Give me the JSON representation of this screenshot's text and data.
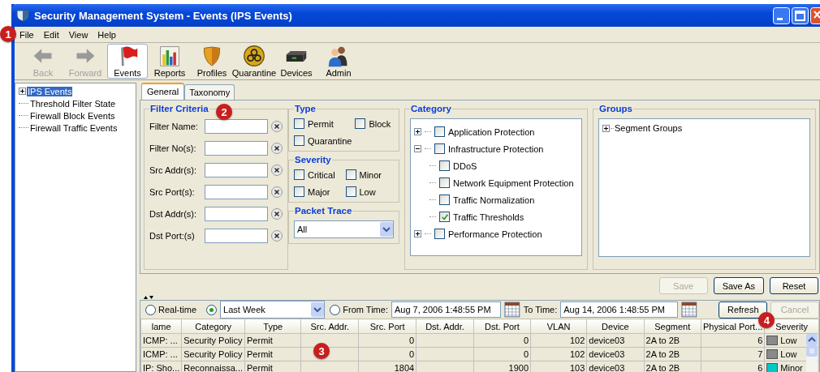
{
  "window": {
    "title": "Security Management System - Events (IPS Events)"
  },
  "menu": {
    "items": [
      "File",
      "Edit",
      "View",
      "Help"
    ],
    "callout": "1"
  },
  "toolbar": [
    {
      "label": "Back",
      "kind": "back",
      "disabled": true,
      "selected": false
    },
    {
      "label": "Forward",
      "kind": "forward",
      "disabled": true,
      "selected": false
    },
    {
      "label": "Events",
      "kind": "events",
      "disabled": false,
      "selected": true
    },
    {
      "label": "Reports",
      "kind": "reports",
      "disabled": false,
      "selected": false
    },
    {
      "label": "Profiles",
      "kind": "profiles",
      "disabled": false,
      "selected": false
    },
    {
      "label": "Quarantine",
      "kind": "quarantine",
      "disabled": false,
      "selected": false
    },
    {
      "label": "Devices",
      "kind": "devices",
      "disabled": false,
      "selected": false
    },
    {
      "label": "Admin",
      "kind": "admin",
      "disabled": false,
      "selected": false
    }
  ],
  "sidebar": {
    "items": [
      {
        "label": "IPS Events",
        "selected": true,
        "expandable": true
      },
      {
        "label": "Threshold Filter State",
        "selected": false,
        "expandable": false
      },
      {
        "label": "Firewall Block Events",
        "selected": false,
        "expandable": false
      },
      {
        "label": "Firewall Traffic Events",
        "selected": false,
        "expandable": false
      }
    ]
  },
  "tabs": [
    {
      "label": "General",
      "selected": true
    },
    {
      "label": "Taxonomy",
      "selected": false
    }
  ],
  "filter_criteria": {
    "title": "Filter Criteria",
    "callout": "2",
    "fields": [
      "Filter Name:",
      "Filter No(s):",
      "Src Addr(s):",
      "Src Port(s):",
      "Dst Addr(s):",
      "Dst Port:(s)"
    ]
  },
  "type": {
    "title": "Type",
    "options": [
      {
        "label": "Permit",
        "checked": false
      },
      {
        "label": "Block",
        "checked": false
      },
      {
        "label": "Quarantine",
        "checked": false
      }
    ]
  },
  "severity": {
    "title": "Severity",
    "options": [
      {
        "label": "Critical",
        "checked": false
      },
      {
        "label": "Minor",
        "checked": false
      },
      {
        "label": "Major",
        "checked": false
      },
      {
        "label": "Low",
        "checked": false
      }
    ]
  },
  "packet_trace": {
    "title": "Packet Trace",
    "value": "All"
  },
  "category": {
    "title": "Category",
    "items": [
      {
        "label": "Application Protection",
        "checked": false,
        "expanded": false
      },
      {
        "label": "Infrastructure Protection",
        "checked": false,
        "expanded": true,
        "children": [
          {
            "label": "DDoS",
            "checked": false
          },
          {
            "label": "Network Equipment Protection",
            "checked": false
          },
          {
            "label": "Traffic Normalization",
            "checked": false
          },
          {
            "label": "Traffic Thresholds",
            "checked": true
          }
        ]
      },
      {
        "label": "Performance Protection",
        "checked": false,
        "expanded": false
      }
    ]
  },
  "groups": {
    "title": "Groups",
    "items": [
      {
        "label": "Segment Groups",
        "expanded": false
      }
    ]
  },
  "buttons": [
    {
      "label": "Save",
      "disabled": true
    },
    {
      "label": "Save As",
      "disabled": false
    },
    {
      "label": "Reset",
      "disabled": false
    }
  ],
  "time_range": {
    "realtime": {
      "label": "Real-time",
      "selected": false
    },
    "preset": {
      "value": "Last Week",
      "selected": true
    },
    "from": {
      "label": "From Time:",
      "selected": false,
      "value": "Aug 7, 2006 1:48:55 PM"
    },
    "to": {
      "label": "To Time:",
      "value": "Aug 14, 2006 1:48:55 PM"
    },
    "buttons": [
      {
        "label": "Refresh",
        "disabled": false
      },
      {
        "label": "Cancel",
        "disabled": true
      }
    ]
  },
  "table": {
    "callout": "3",
    "columns": [
      {
        "label": "lame"
      },
      {
        "label": "Category"
      },
      {
        "label": "Type"
      },
      {
        "label": "Src. Addr."
      },
      {
        "label": "Src. Port"
      },
      {
        "label": "Dst. Addr."
      },
      {
        "label": "Dst. Port"
      },
      {
        "label": "VLAN"
      },
      {
        "label": "Device"
      },
      {
        "label": "Segment"
      },
      {
        "label": "Physical Port..."
      },
      {
        "label": "Severity",
        "callout": "4"
      }
    ],
    "rows": [
      {
        "cells": [
          "ICMP: ...",
          "Security Policy",
          "Permit",
          null,
          "0",
          null,
          "0",
          "102",
          "device03",
          "2A to 2B",
          "6"
        ],
        "severity": {
          "label": "Low",
          "color": "#8a8a8a"
        }
      },
      {
        "cells": [
          "ICMP: ...",
          "Security Policy",
          "Permit",
          null,
          "0",
          null,
          "0",
          "102",
          "device03",
          "2A to 2B",
          "7"
        ],
        "severity": {
          "label": "Low",
          "color": "#8a8a8a"
        }
      },
      {
        "cells": [
          "IP: Sho...",
          "Reconnaissa...",
          "Permit",
          null,
          "1804",
          null,
          "1900",
          "103",
          "device03",
          "2A to 2B",
          "6"
        ],
        "severity": {
          "label": "Minor",
          "color": "#00c8c8"
        }
      }
    ]
  }
}
